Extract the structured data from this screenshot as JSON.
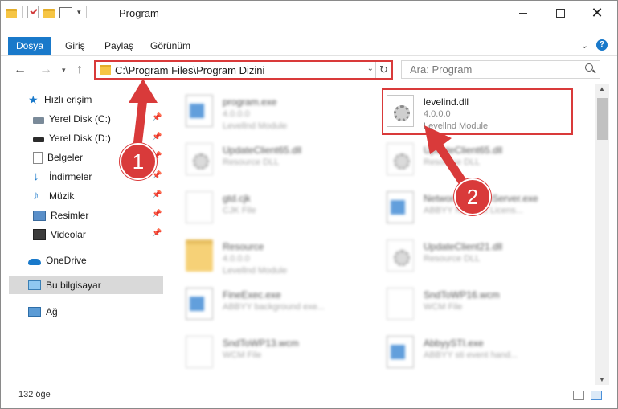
{
  "window": {
    "title": "Program",
    "qat_icons": [
      "folder-icon",
      "properties-check-icon",
      "folder-icon",
      "customize-icon"
    ],
    "controls": {
      "minimize": "minimize-icon",
      "maximize": "maximize-icon",
      "close": "✕"
    }
  },
  "ribbon": {
    "tabs": [
      {
        "label": "Dosya",
        "active": true
      },
      {
        "label": "Giriş"
      },
      {
        "label": "Paylaş"
      },
      {
        "label": "Görünüm"
      }
    ],
    "help": "?"
  },
  "nav": {
    "address": "C:\\Program Files\\Program Dizini",
    "search_placeholder": "Ara: Program"
  },
  "sidebar": {
    "items": [
      {
        "label": "Hızlı erişim",
        "icon": "star-icon"
      },
      {
        "label": "Yerel Disk (C:)",
        "icon": "drive-icon",
        "pinned": true
      },
      {
        "label": "Yerel Disk (D:)",
        "icon": "drive-icon",
        "pinned": true
      },
      {
        "label": "Belgeler",
        "icon": "documents-icon",
        "pinned": true
      },
      {
        "label": "İndirmeler",
        "icon": "download-icon",
        "pinned": true
      },
      {
        "label": "Müzik",
        "icon": "music-icon",
        "pinned": true
      },
      {
        "label": "Resimler",
        "icon": "pictures-icon",
        "pinned": true
      },
      {
        "label": "Videolar",
        "icon": "videos-icon",
        "pinned": true
      },
      {
        "label": "OneDrive",
        "icon": "cloud-icon"
      },
      {
        "label": "Bu bilgisayar",
        "icon": "computer-icon",
        "selected": true
      },
      {
        "label": "Ağ",
        "icon": "network-icon"
      }
    ]
  },
  "files": [
    {
      "name": "program.exe",
      "line2": "4.0.0.0",
      "line3": "Levellnd Module",
      "icon": "application-icon",
      "blurred": true
    },
    {
      "name": "levelind.dll",
      "line2": "4.0.0.0",
      "line3": "Levellnd Module",
      "icon": "dll-gear-icon",
      "blurred": false
    },
    {
      "name": "UpdateClient65.dll",
      "line2": "Resource DLL",
      "line3": "",
      "icon": "dll-gear-icon",
      "blurred": true
    },
    {
      "name": "UpdateClient65.dll",
      "line2": "Resource DLL",
      "line3": "",
      "icon": "dll-gear-icon",
      "blurred": true
    },
    {
      "name": "gtd.cjk",
      "line2": "CJK File",
      "line3": "",
      "icon": "document-icon",
      "blurred": true
    },
    {
      "name": "NetworkLicenseServer.exe",
      "line2": "ABBYY Network Licens...",
      "line3": "",
      "icon": "window-app-icon",
      "blurred": true
    },
    {
      "name": "Resource",
      "line2": "4.0.0.0",
      "line3": "Levellnd Module",
      "icon": "folder-icon",
      "blurred": true
    },
    {
      "name": "UpdateClient21.dll",
      "line2": "Resource DLL",
      "line3": "",
      "icon": "dll-gear-icon",
      "blurred": true
    },
    {
      "name": "FineExec.exe",
      "line2": "ABBYY background exe...",
      "line3": "",
      "icon": "window-app-icon",
      "blurred": true
    },
    {
      "name": "SndToWP16.wcm",
      "line2": "WCM File",
      "line3": "",
      "icon": "document-icon",
      "blurred": true
    },
    {
      "name": "SndToWP13.wcm",
      "line2": "WCM File",
      "line3": "",
      "icon": "document-icon",
      "blurred": true
    },
    {
      "name": "AbbyySTI.exe",
      "line2": "ABBYY sti event hand...",
      "line3": "",
      "icon": "window-app-icon",
      "blurred": true
    }
  ],
  "status": {
    "item_count": "132 öğe"
  },
  "annotations": {
    "marker1": "1",
    "marker2": "2",
    "color": "#d93a3a"
  },
  "colors": {
    "accent": "#1979ca",
    "highlight": "#d93a3a"
  }
}
